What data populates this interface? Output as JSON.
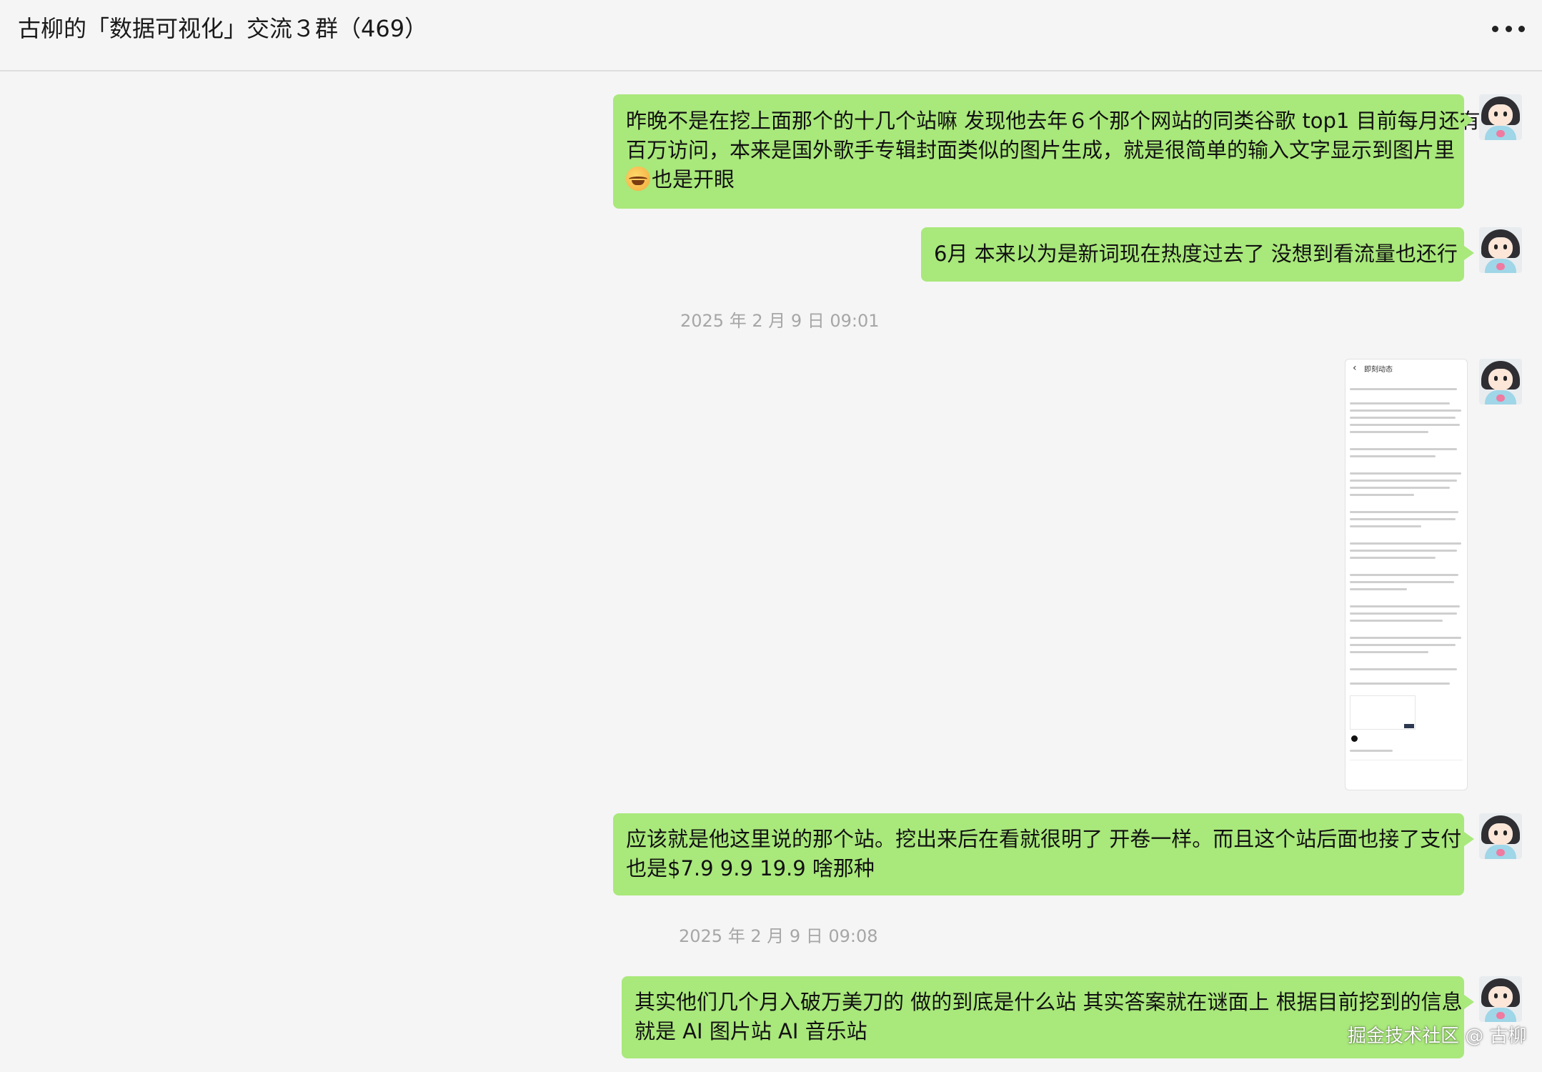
{
  "header": {
    "title": "古柳的「数据可视化」交流３群（469）",
    "more_icon": "more-horizontal-icon"
  },
  "messages": [
    {
      "type": "text",
      "sender": "self",
      "lines": [
        "昨晚不是在挖上面那个的十几个站嘛 发现他去年６个那个网站的同类谷歌 top1 目前每月还有",
        "百万访问，本来是国外歌手专辑封面类似的图片生成，就是很简单的输入文字显示到图片里",
        "也是开眼"
      ],
      "emoji": "laughing-crying-emoji"
    },
    {
      "type": "text",
      "sender": "self",
      "lines": [
        "6月 本来以为是新词现在热度过去了 没想到看流量也还行"
      ]
    },
    {
      "type": "timestamp",
      "text": "2025 年 2 月 9 日 09:01"
    },
    {
      "type": "image",
      "sender": "self",
      "image": {
        "back": "‹",
        "title": "即刻动态"
      }
    },
    {
      "type": "text",
      "sender": "self",
      "lines": [
        "应该就是他这里说的那个站。挖出来后在看就很明了 开卷一样。而且这个站后面也接了支付",
        "也是$7.9 9.9 19.9 啥那种"
      ]
    },
    {
      "type": "timestamp",
      "text": "2025 年 2 月 9 日 09:08"
    },
    {
      "type": "text",
      "sender": "self",
      "lines": [
        "其实他们几个月入破万美刀的 做的到底是什么站 其实答案就在谜面上 根据目前挖到的信息",
        "就是 AI 图片站 AI 音乐站"
      ]
    }
  ],
  "watermark": "掘金技术社区 @ 古柳",
  "colors": {
    "background": "#f5f5f5",
    "bubble_self": "#a9e87b",
    "timestamp_text": "#a6a6a6"
  }
}
